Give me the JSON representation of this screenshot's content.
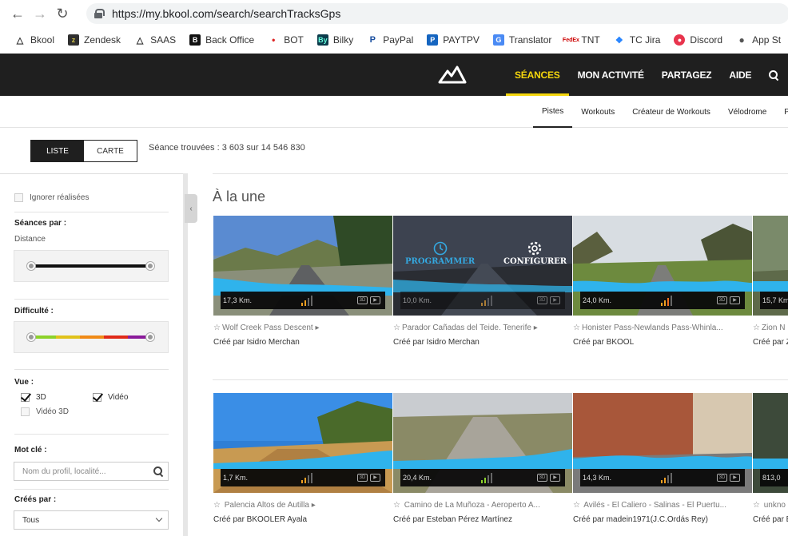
{
  "browser": {
    "url": "https://my.bkool.com/search/searchTracksGps",
    "bookmarks": [
      "Bkool",
      "Zendesk",
      "SAAS",
      "Back Office",
      "BOT",
      "Bilky",
      "PayPal",
      "PAYTPV",
      "Translator",
      "TNT",
      "TC Jira",
      "Discord",
      "App St"
    ]
  },
  "header": {
    "nav": [
      "SÉANCES",
      "MON ACTIVITÉ",
      "PARTAGEZ",
      "AIDE"
    ],
    "accent": "#f5d60c"
  },
  "subnav": [
    "Pistes",
    "Workouts",
    "Créateur de Workouts",
    "Vélodrome",
    "Progr"
  ],
  "view_toggle": {
    "list": "LISTE",
    "map": "CARTE"
  },
  "found_text": "Séance trouvées : 3 603 sur 14 546 830",
  "sidebar": {
    "ignore_done": "Ignorer réalisées",
    "sessions_by": "Séances par :",
    "distance": "Distance",
    "difficulty": "Difficulté :",
    "view": "Vue :",
    "opt_3d": "3D",
    "opt_video": "Vidéo",
    "opt_video3d": "Vidéo 3D",
    "keyword": "Mot clé :",
    "keyword_placeholder": "Nom du profil, localité...",
    "created_by": "Créés par :",
    "created_by_value": "Tous"
  },
  "section_title": "À la une",
  "overlay": {
    "programmer": "PROGRAMMER",
    "configurer": "CONFIGURER"
  },
  "cards": [
    {
      "km": "17,3 Km.",
      "title": "Wolf Creek Pass Descent",
      "author": "Créé par Isidro Merchan"
    },
    {
      "km": "10,0 Km.",
      "title": "Parador Cañadas del Teide. Tenerife",
      "author": "Créé par Isidro Merchan"
    },
    {
      "km": "24,0 Km.",
      "title": "Honister Pass-Newlands Pass-Whinla...",
      "author": "Créé par BKOOL"
    },
    {
      "km": "15,7 Km.",
      "title": "Zion N",
      "author": "Créé par Z"
    },
    {
      "km": "1,7 Km.",
      "title": "Palencia Altos de Autilla",
      "author": "Créé par BKOOLER Ayala"
    },
    {
      "km": "20,4 Km.",
      "title": "Camino de La Muñoza - Aeroperto A...",
      "author": "Créé par Esteban Pérez Martínez"
    },
    {
      "km": "14,3 Km.",
      "title": "Avilés - El Caliero - Salinas - El Puertu...",
      "author": "Créé par madein1971(J.C.Ordás Rey)"
    },
    {
      "km": "813,0",
      "title": "unkno",
      "author": "Créé par B"
    }
  ]
}
